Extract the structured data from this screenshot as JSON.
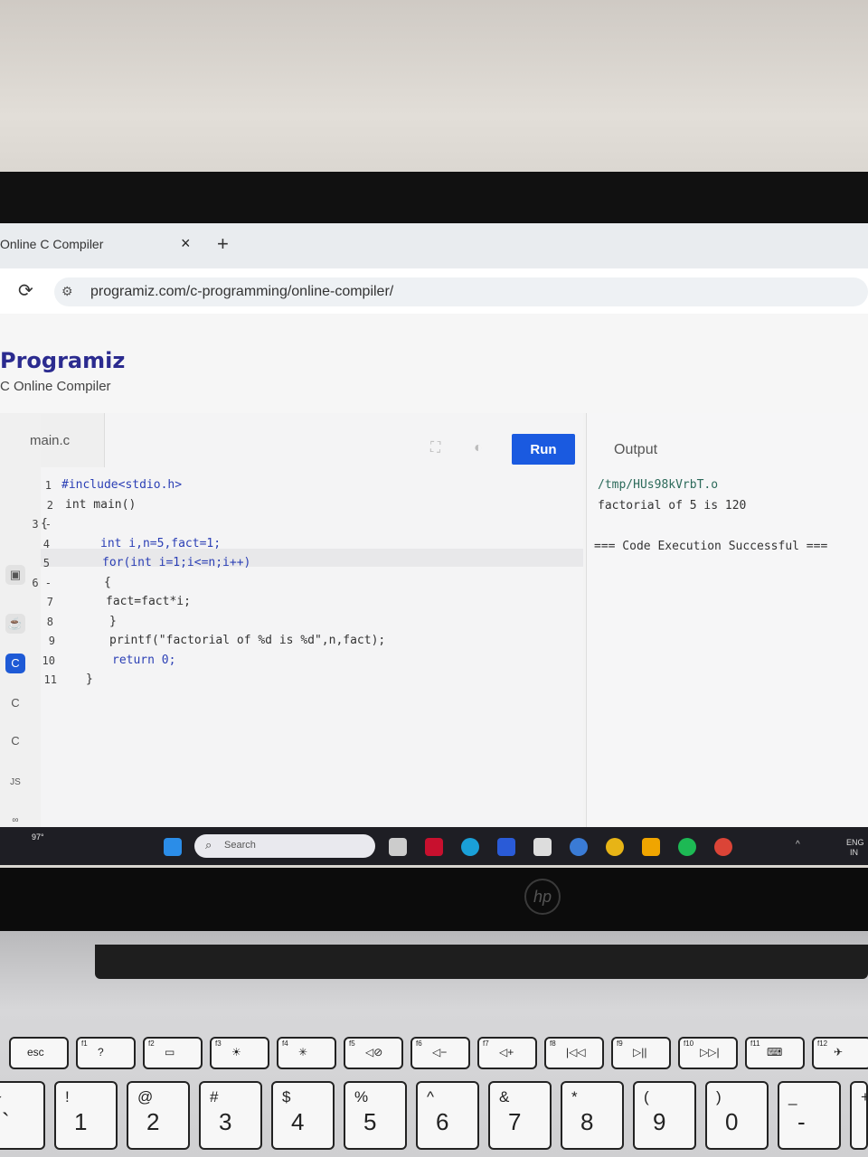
{
  "browser": {
    "tab_title": "Online C Compiler",
    "tab_close": "×",
    "new_tab": "+",
    "reload_icon": "reload-icon",
    "url": "programiz.com/c-programming/online-compiler/"
  },
  "site": {
    "logo": "Programiz",
    "subtitle": "C Online Compiler"
  },
  "editor": {
    "file_name": "main.c",
    "run_label": "Run",
    "lines": [
      {
        "num": "1",
        "code": "#include<stdio.h>"
      },
      {
        "num": "2",
        "code": "int main()"
      },
      {
        "num": "3 -",
        "code": "{"
      },
      {
        "num": "4",
        "code": "int i,n=5,fact=1;"
      },
      {
        "num": "5",
        "code": "for(int i=1;i<=n;i++)"
      },
      {
        "num": "6 -",
        "code": "{"
      },
      {
        "num": "7",
        "code": "fact=fact*i;"
      },
      {
        "num": "8",
        "code": "}"
      },
      {
        "num": "9",
        "code": "printf(\"factorial of %d is %d\",n,fact);"
      },
      {
        "num": "10",
        "code": "return 0;"
      },
      {
        "num": "11",
        "code": "}"
      }
    ]
  },
  "output": {
    "title": "Output",
    "lines": [
      "/tmp/HUs98kVrbT.o",
      "factorial of 5 is 120",
      "=== Code Execution Successful ==="
    ]
  },
  "sidebar": {
    "js_label": "JS"
  },
  "taskbar": {
    "temp": "97°",
    "search_placeholder": "Search",
    "lang": "ENG",
    "region": "IN"
  },
  "laptop": {
    "brand": "hp"
  },
  "keyboard": {
    "fkeys": [
      {
        "fn": "",
        "sym": "esc"
      },
      {
        "fn": "f1",
        "sym": "?"
      },
      {
        "fn": "f2",
        "sym": "▭"
      },
      {
        "fn": "f3",
        "sym": "☀"
      },
      {
        "fn": "f4",
        "sym": "✳"
      },
      {
        "fn": "f5",
        "sym": "◁⊘"
      },
      {
        "fn": "f6",
        "sym": "◁−"
      },
      {
        "fn": "f7",
        "sym": "◁+"
      },
      {
        "fn": "f8",
        "sym": "|◁◁"
      },
      {
        "fn": "f9",
        "sym": "▷||"
      },
      {
        "fn": "f10",
        "sym": "▷▷|"
      },
      {
        "fn": "f11",
        "sym": "⌨"
      },
      {
        "fn": "f12",
        "sym": "✈"
      }
    ],
    "numkeys": [
      {
        "top": "~",
        "bot": "`"
      },
      {
        "top": "!",
        "bot": "1"
      },
      {
        "top": "@",
        "bot": "2"
      },
      {
        "top": "#",
        "bot": "3"
      },
      {
        "top": "$",
        "bot": "4"
      },
      {
        "top": "%",
        "bot": "5"
      },
      {
        "top": "^",
        "bot": "6"
      },
      {
        "top": "&",
        "bot": "7"
      },
      {
        "top": "*",
        "bot": "8"
      },
      {
        "top": "(",
        "bot": "9"
      },
      {
        "top": ")",
        "bot": "0"
      },
      {
        "top": "_",
        "bot": "-"
      },
      {
        "top": "+",
        "bot": ""
      }
    ]
  }
}
